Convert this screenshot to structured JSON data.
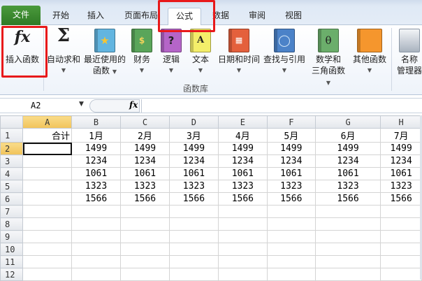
{
  "tabs": [
    {
      "label": "文件"
    },
    {
      "label": "开始"
    },
    {
      "label": "插入"
    },
    {
      "label": "页面布局"
    },
    {
      "label": "公式",
      "active": true
    },
    {
      "label": "数据"
    },
    {
      "label": "审阅"
    },
    {
      "label": "视图"
    }
  ],
  "ribbon": {
    "buttons": [
      {
        "label": "插入函数",
        "icon": "fx-icon"
      },
      {
        "label": "自动求和",
        "icon": "sigma-icon"
      },
      {
        "label1": "最近使用的",
        "label2": "函数",
        "icon": "recent-book-icon"
      },
      {
        "label": "财务",
        "icon": "finance-book-icon"
      },
      {
        "label": "逻辑",
        "icon": "logic-book-icon"
      },
      {
        "label": "文本",
        "icon": "text-book-icon"
      },
      {
        "label": "日期和时间",
        "icon": "datetime-book-icon"
      },
      {
        "label": "查找与引用",
        "icon": "lookup-book-icon"
      },
      {
        "label1": "数学和",
        "label2": "三角函数",
        "icon": "math-book-icon"
      },
      {
        "label": "其他函数",
        "icon": "more-books-icon"
      },
      {
        "label1": "名称",
        "label2": "管理器",
        "icon": "name-manager-icon"
      }
    ],
    "group_label": "函数库"
  },
  "formula_bar": {
    "name_box": "A2",
    "fx": "fx",
    "value": ""
  },
  "sheet": {
    "columns": [
      "A",
      "B",
      "C",
      "D",
      "E",
      "F",
      "G",
      "H"
    ],
    "rows": [
      [
        "合计",
        "1月",
        "2月",
        "3月",
        "4月",
        "5月",
        "6月",
        "7月"
      ],
      [
        "",
        "1499",
        "1499",
        "1499",
        "1499",
        "1499",
        "1499",
        "1499"
      ],
      [
        "",
        "1234",
        "1234",
        "1234",
        "1234",
        "1234",
        "1234",
        "1234"
      ],
      [
        "",
        "1061",
        "1061",
        "1061",
        "1061",
        "1061",
        "1061",
        "1061"
      ],
      [
        "",
        "1323",
        "1323",
        "1323",
        "1323",
        "1323",
        "1323",
        "1323"
      ],
      [
        "",
        "1566",
        "1566",
        "1566",
        "1566",
        "1566",
        "1566",
        "1566"
      ],
      [
        "",
        "",
        "",
        "",
        "",
        "",
        "",
        ""
      ],
      [
        "",
        "",
        "",
        "",
        "",
        "",
        "",
        ""
      ],
      [
        "",
        "",
        "",
        "",
        "",
        "",
        "",
        ""
      ],
      [
        "",
        "",
        "",
        "",
        "",
        "",
        "",
        ""
      ],
      [
        "",
        "",
        "",
        "",
        "",
        "",
        "",
        ""
      ],
      [
        "",
        "",
        "",
        "",
        "",
        "",
        "",
        ""
      ]
    ],
    "active_cell": "A2"
  },
  "colors": {
    "file_tab": "#2f7a25",
    "highlight": "#e8191a",
    "selected_header": "#f1c35a"
  }
}
